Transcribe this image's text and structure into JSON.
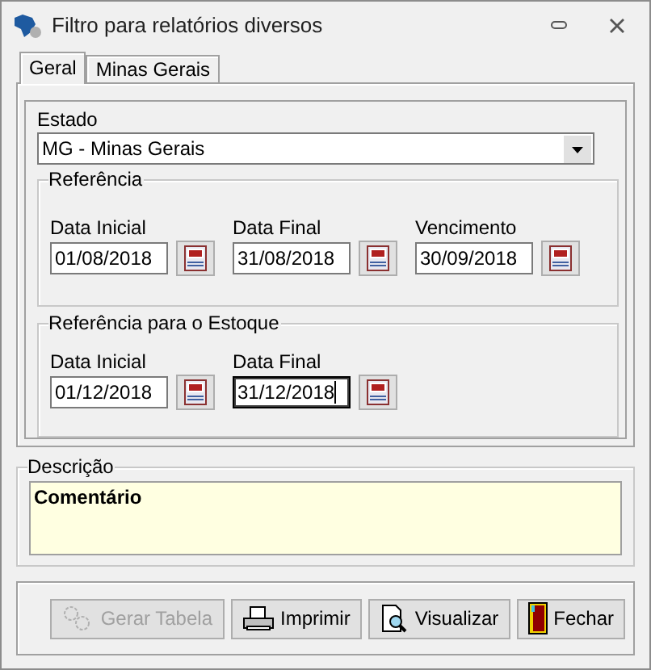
{
  "window": {
    "title": "Filtro para relatórios diversos"
  },
  "tabs": [
    {
      "label": "Geral",
      "selected": true
    },
    {
      "label": "Minas Gerais",
      "selected": false
    }
  ],
  "estado": {
    "label": "Estado",
    "value": "MG - Minas Gerais"
  },
  "groups": [
    {
      "title": "Referência",
      "fields": [
        {
          "label": "Data Inicial",
          "value": "01/08/2018",
          "focused": false
        },
        {
          "label": "Data Final",
          "value": "31/08/2018",
          "focused": false
        },
        {
          "label": "Vencimento",
          "value": "30/09/2018",
          "focused": false
        }
      ]
    },
    {
      "title": "Referência para o Estoque",
      "fields": [
        {
          "label": "Data Inicial",
          "value": "01/12/2018",
          "focused": false
        },
        {
          "label": "Data Final",
          "value": "31/12/2018",
          "focused": true
        }
      ]
    }
  ],
  "descricao": {
    "title": "Descrição",
    "value": "Comentário"
  },
  "buttons": [
    {
      "label": "Gerar Tabela",
      "kind": "table",
      "disabled": true
    },
    {
      "label": "Imprimir",
      "kind": "print",
      "disabled": false
    },
    {
      "label": "Visualizar",
      "kind": "preview",
      "disabled": false
    },
    {
      "label": "Fechar",
      "kind": "close",
      "disabled": false
    }
  ]
}
